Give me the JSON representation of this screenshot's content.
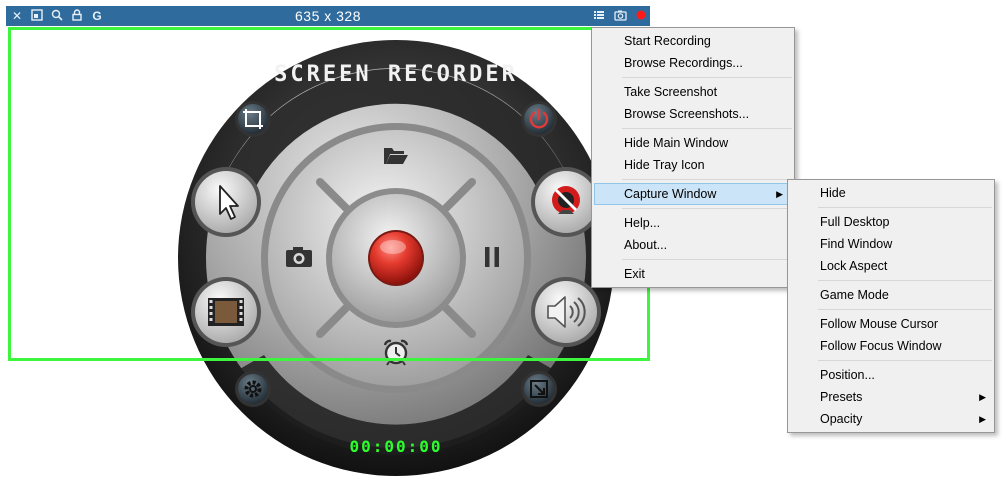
{
  "toolbar": {
    "dimensions": "635 x 328",
    "icons": [
      "close-icon",
      "restore-icon",
      "zoom-icon",
      "lock-icon",
      "grab-icon",
      "list-icon",
      "camera-icon",
      "record-dot-icon"
    ],
    "grab_label": "G",
    "frame_color": "#3cf53c",
    "bar_color": "#2f6c9d"
  },
  "recorder": {
    "title": "SCREEN RECORDER",
    "timer": "00:00:00",
    "buttons": [
      "crop-icon",
      "power-icon",
      "cursor-icon",
      "webcam-off-icon",
      "film-icon",
      "speaker-icon",
      "settings-gear-icon",
      "resize-icon",
      "folder-icon",
      "camera-icon",
      "record-icon",
      "pause-icon",
      "alarm-clock-icon"
    ],
    "record_color": "#e53a2e",
    "timer_color": "#2bff2b"
  },
  "context_menu": {
    "items": [
      {
        "label": "Start Recording"
      },
      {
        "label": "Browse Recordings..."
      },
      {
        "sep": true
      },
      {
        "label": "Take Screenshot"
      },
      {
        "label": "Browse Screenshots..."
      },
      {
        "sep": true
      },
      {
        "label": "Hide Main Window"
      },
      {
        "label": "Hide Tray Icon"
      },
      {
        "sep": true
      },
      {
        "label": "Capture Window",
        "submenu": true,
        "highlighted": true
      },
      {
        "sep": true
      },
      {
        "label": "Help..."
      },
      {
        "label": "About..."
      },
      {
        "sep": true
      },
      {
        "label": "Exit"
      }
    ]
  },
  "submenu": {
    "items": [
      {
        "label": "Hide"
      },
      {
        "sep": true
      },
      {
        "label": "Full Desktop"
      },
      {
        "label": "Find Window"
      },
      {
        "label": "Lock Aspect"
      },
      {
        "sep": true
      },
      {
        "label": "Game Mode"
      },
      {
        "sep": true
      },
      {
        "label": "Follow Mouse Cursor"
      },
      {
        "label": "Follow Focus Window"
      },
      {
        "sep": true
      },
      {
        "label": "Position..."
      },
      {
        "label": "Presets",
        "submenu": true
      },
      {
        "label": "Opacity",
        "submenu": true
      }
    ]
  }
}
